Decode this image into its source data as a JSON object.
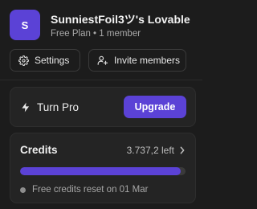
{
  "workspace": {
    "avatar_letter": "S",
    "name": "SunniestFoil3ツ's Lovable",
    "plan": "Free Plan • 1 member"
  },
  "actions": {
    "settings_label": "Settings",
    "invite_label": "Invite members"
  },
  "pro": {
    "label": "Turn Pro",
    "upgrade_label": "Upgrade"
  },
  "credits": {
    "title": "Credits",
    "left_text": "3.737,2 left",
    "used_fraction": 0.97,
    "reset_text": "Free credits reset on 01 Mar"
  },
  "colors": {
    "accent": "#5b42d6",
    "background": "#1c1c1c",
    "card": "#242424"
  }
}
